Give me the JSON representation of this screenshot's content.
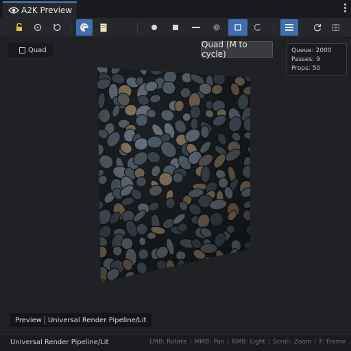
{
  "tab": {
    "title": "A2K Preview"
  },
  "toolbar": {
    "buttons": [
      "lock-icon",
      "target-icon",
      "reset-icon",
      "palette-icon",
      "document-icon",
      "sphere-icon",
      "cube-icon",
      "plane-icon",
      "cylinder-icon",
      "quad-icon",
      "custom-mesh-icon",
      "menu-icon",
      "refresh-icon",
      "grid-icon"
    ],
    "active": [
      "palette-icon",
      "quad-icon",
      "menu-icon"
    ]
  },
  "viewport": {
    "mesh_label": "Quad",
    "tooltip": "Quad (M to cycle)",
    "stats": [
      {
        "label": "Queue:",
        "value": "2000"
      },
      {
        "label": "Passes:",
        "value": "9"
      },
      {
        "label": "Props:",
        "value": "50"
      }
    ],
    "pipeline_badge": {
      "left": "Preview",
      "right": "Universal Render Pipeline/Lit"
    },
    "colors": {
      "accent": "#3f6eae",
      "stone": "#4d5a66",
      "mortar": "#1c2024"
    }
  },
  "status": {
    "shader": "Universal Render Pipeline/Lit",
    "hints": [
      "LMB: Rotate",
      "MMB: Pan",
      "RMB: Light",
      "Scroll: Zoom",
      "F: Frame"
    ]
  }
}
